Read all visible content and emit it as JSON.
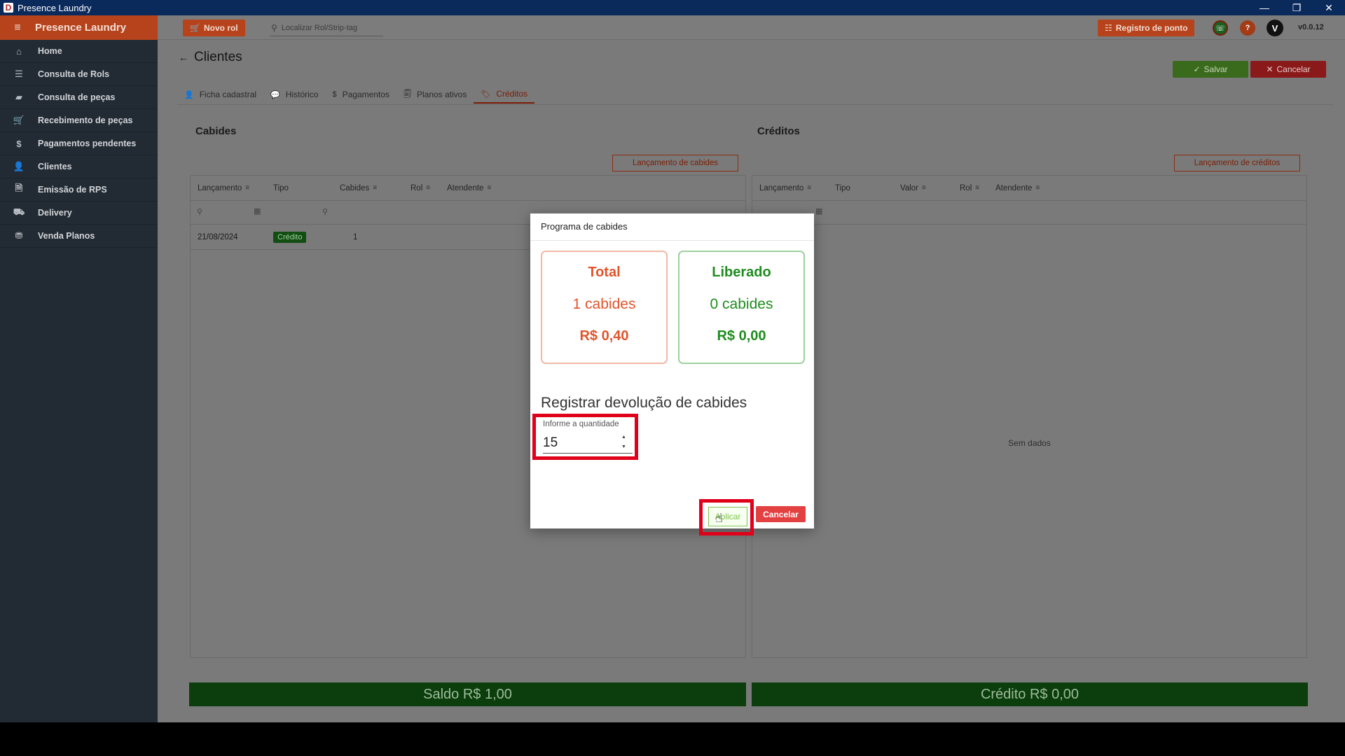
{
  "window": {
    "title": "Presence Laundry",
    "logo_letter": "D"
  },
  "sidebar": {
    "brand": "Presence Laundry",
    "items": [
      {
        "label": "Home",
        "icon": "⌂"
      },
      {
        "label": "Consulta de Rols",
        "icon": "☰"
      },
      {
        "label": "Consulta de peças",
        "icon": "▰"
      },
      {
        "label": "Recebimento de peças",
        "icon": "🛒"
      },
      {
        "label": "Pagamentos pendentes",
        "icon": "$"
      },
      {
        "label": "Clientes",
        "icon": "👤"
      },
      {
        "label": "Emissão de RPS",
        "icon": "🗎"
      },
      {
        "label": "Delivery",
        "icon": "⛟"
      },
      {
        "label": "Venda Planos",
        "icon": "⛃"
      }
    ]
  },
  "topbar": {
    "novo_rol": "Novo rol",
    "search_placeholder": "Localizar Rol/Strip-tag",
    "registro_ponto": "Registro de ponto",
    "avatar_letter": "V",
    "version": "v0.0.12",
    "colors": {
      "accent": "#b6431c",
      "whatsapp": "#1b5e20",
      "help": "#a33b16"
    }
  },
  "page": {
    "title": "Clientes",
    "salvar": "Salvar",
    "cancelar": "Cancelar",
    "tabs": [
      {
        "label": "Ficha cadastral",
        "icon": "👤"
      },
      {
        "label": "Histórico",
        "icon": "💬"
      },
      {
        "label": "Pagamentos",
        "icon": "$"
      },
      {
        "label": "Planos ativos",
        "icon": "🗐"
      },
      {
        "label": "Créditos",
        "icon": "🏷"
      }
    ]
  },
  "cabides": {
    "title": "Cabides",
    "button": "Lançamento de cabides",
    "columns": [
      "Lançamento",
      "Tipo",
      "Cabides",
      "Rol",
      "Atendente"
    ],
    "rows": [
      {
        "lancamento": "21/08/2024",
        "tipo": "Crédito",
        "cabides": "1"
      }
    ],
    "saldo": "Saldo R$ 1,00"
  },
  "creditos": {
    "title": "Créditos",
    "button": "Lançamento de créditos",
    "columns": [
      "Lançamento",
      "Tipo",
      "Valor",
      "Rol",
      "Atendente"
    ],
    "empty": "Sem dados",
    "credito": "Crédito R$ 0,00"
  },
  "modal": {
    "title": "Programa de cabides",
    "total": {
      "title": "Total",
      "count": "1 cabides",
      "value": "R$ 0,40"
    },
    "liberado": {
      "title": "Liberado",
      "count": "0 cabides",
      "value": "R$ 0,00"
    },
    "subtitle": "Registrar devolução de cabides",
    "qty_label": "Informe a quantidade",
    "qty_value": "15",
    "aplicar": "Aplicar",
    "cancelar": "Cancelar"
  }
}
